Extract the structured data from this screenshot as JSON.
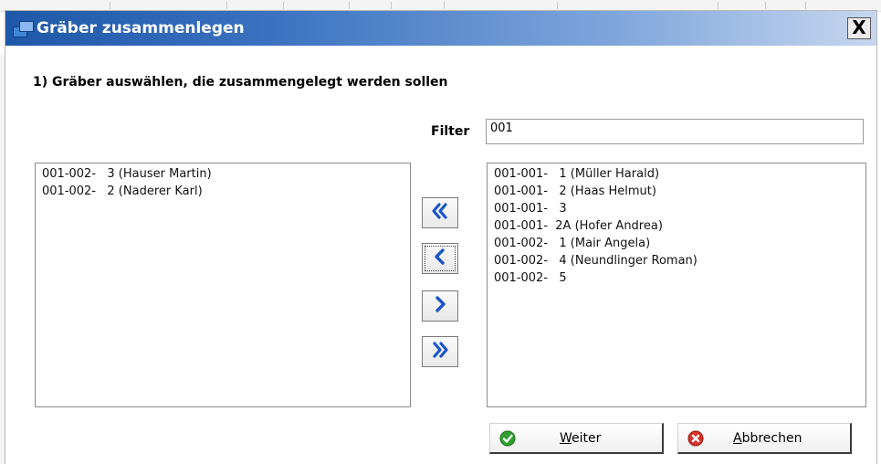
{
  "window": {
    "title": "Gräber zusammenlegen",
    "close_glyph": "X"
  },
  "step_heading": "1) Gräber auswählen, die zusammengelegt werden sollen",
  "filter": {
    "label": "Filter",
    "value": "001"
  },
  "left_list": {
    "items": [
      "001-002-   3 (Hauser Martin)",
      "001-002-   2 (Naderer Karl)"
    ]
  },
  "right_list": {
    "items": [
      "001-001-   1 (Müller Harald)",
      "001-001-   2 (Haas Helmut)",
      "001-001-   3",
      "001-001-  2A (Hofer Andrea)",
      "001-002-   1 (Mair Angela)",
      "001-002-   4 (Neundlinger Roman)",
      "001-002-   5"
    ]
  },
  "move_buttons": [
    {
      "icon": "double-chevron-left-icon"
    },
    {
      "icon": "chevron-left-icon"
    },
    {
      "icon": "chevron-right-icon"
    },
    {
      "icon": "double-chevron-right-icon"
    }
  ],
  "buttons": {
    "weiter": {
      "mnemonic": "W",
      "rest": "eiter",
      "icon": "green-check-icon"
    },
    "abbrechen": {
      "mnemonic": "A",
      "rest": "bbrechen",
      "icon": "red-x-icon"
    }
  },
  "colors": {
    "titlebar_start": "#1f58a8",
    "arrow_blue": "#1a56c8",
    "ok_green": "#2e9e2e",
    "cancel_red": "#d8312a"
  }
}
